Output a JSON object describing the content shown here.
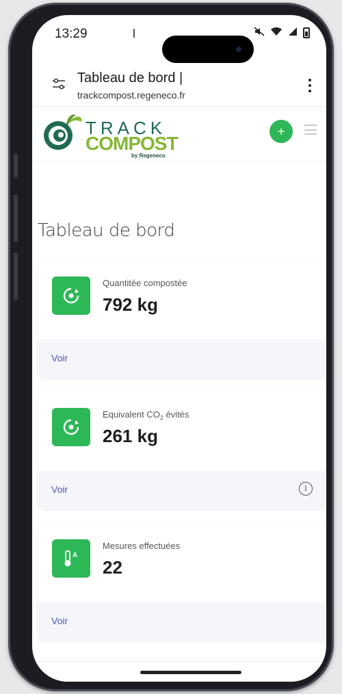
{
  "status_bar": {
    "time": "13:29"
  },
  "browser": {
    "tab_title": "Tableau de bord |",
    "domain": "trackcompost.regeneco.fr"
  },
  "brand": {
    "name_line1": "TRACK",
    "name_line2": "COMPOST",
    "tagline": "by Regeneco",
    "colors": {
      "primary_green": "#2eb757",
      "logo_dark": "#1f6a52",
      "logo_lime": "#86b735",
      "link": "#4b55b8"
    }
  },
  "header": {
    "add_button_label": "+"
  },
  "page": {
    "title": "Tableau de bord"
  },
  "cards": [
    {
      "label": "Quantitée compostée",
      "value": "792 kg",
      "link": "Voir",
      "icon": "compost-recycle-icon"
    },
    {
      "label_prefix": "Equivalent CO",
      "label_sub": "2",
      "label_suffix": " évités",
      "value": "261 kg",
      "link": "Voir",
      "icon": "compost-recycle-icon",
      "info_icon": "info-circle-icon"
    },
    {
      "label": "Mesures effectuées",
      "value": "22",
      "link": "Voir",
      "icon": "thermometer-icon"
    }
  ]
}
